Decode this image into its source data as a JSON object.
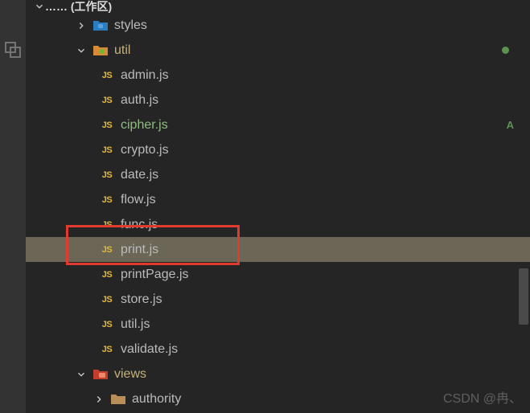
{
  "header": {
    "workspace_suffix": "(工作区)"
  },
  "tree": {
    "styles": {
      "label": "styles"
    },
    "util": {
      "label": "util",
      "badge_type": "dot"
    },
    "files": [
      {
        "label": "admin.js"
      },
      {
        "label": "auth.js"
      },
      {
        "label": "cipher.js",
        "badge": "A"
      },
      {
        "label": "crypto.js"
      },
      {
        "label": "date.js"
      },
      {
        "label": "flow.js"
      },
      {
        "label": "func.js"
      },
      {
        "label": "print.js",
        "selected": true
      },
      {
        "label": "printPage.js"
      },
      {
        "label": "store.js"
      },
      {
        "label": "util.js"
      },
      {
        "label": "validate.js"
      }
    ],
    "views": {
      "label": "views"
    },
    "authority": {
      "label": "authority"
    }
  },
  "watermark": "CSDN @冉、",
  "colors": {
    "folder_orange": "#d88b36",
    "folder_blue": "#2b7dc2",
    "folder_red": "#c43e2e",
    "folder_tan": "#b98e57",
    "js_yellow": "#e2b93d",
    "git_green": "#5d9251"
  }
}
